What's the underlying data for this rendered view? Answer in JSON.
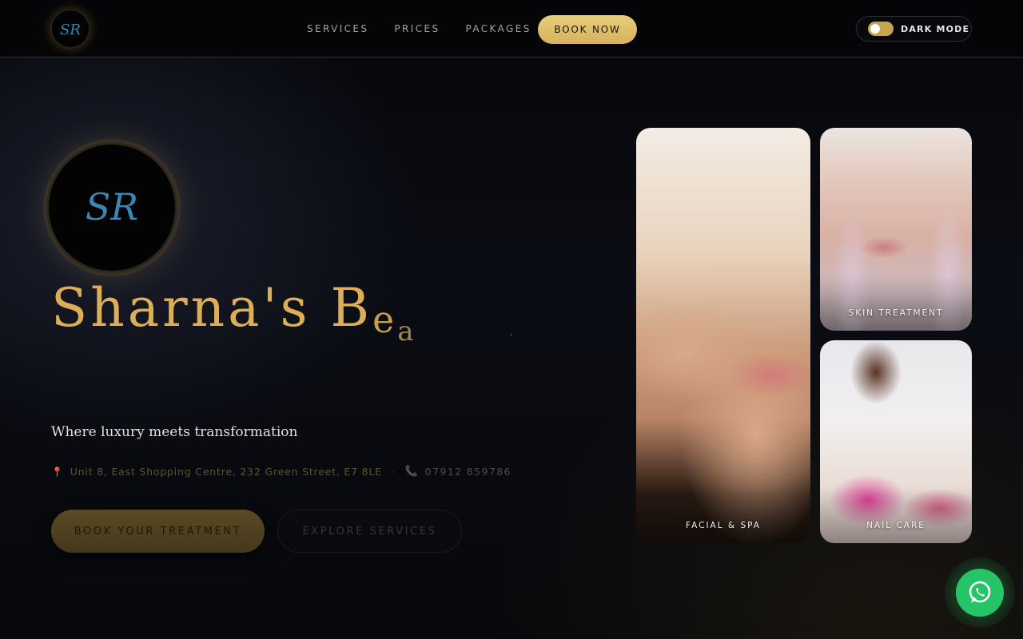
{
  "brand": {
    "monogram": "SR",
    "title_main": "Sharna's B",
    "title_trail_1": "e",
    "title_trail_2": "a",
    "accent_color": "#dcae55",
    "monogram_color": "#3a86b4"
  },
  "nav": {
    "links": [
      "SERVICES",
      "PRICES",
      "PACKAGES"
    ],
    "book_label": "BOOK NOW",
    "dark_mode_label": "DARK MODE",
    "dark_mode_on": true
  },
  "hero": {
    "tagline": "Where luxury meets transformation",
    "address": "Unit 8, East Shopping Centre, 232 Green Street, E7 8LE",
    "phone": "07912 859786",
    "primary_cta": "BOOK YOUR TREATMENT",
    "secondary_cta": "EXPLORE SERVICES"
  },
  "gallery": [
    {
      "label": "FACIAL & SPA"
    },
    {
      "label": "SKIN TREATMENT"
    },
    {
      "label": "NAIL CARE"
    }
  ],
  "icons": {
    "address": "map-pin-icon",
    "phone": "phone-icon",
    "chat": "whatsapp-icon"
  }
}
